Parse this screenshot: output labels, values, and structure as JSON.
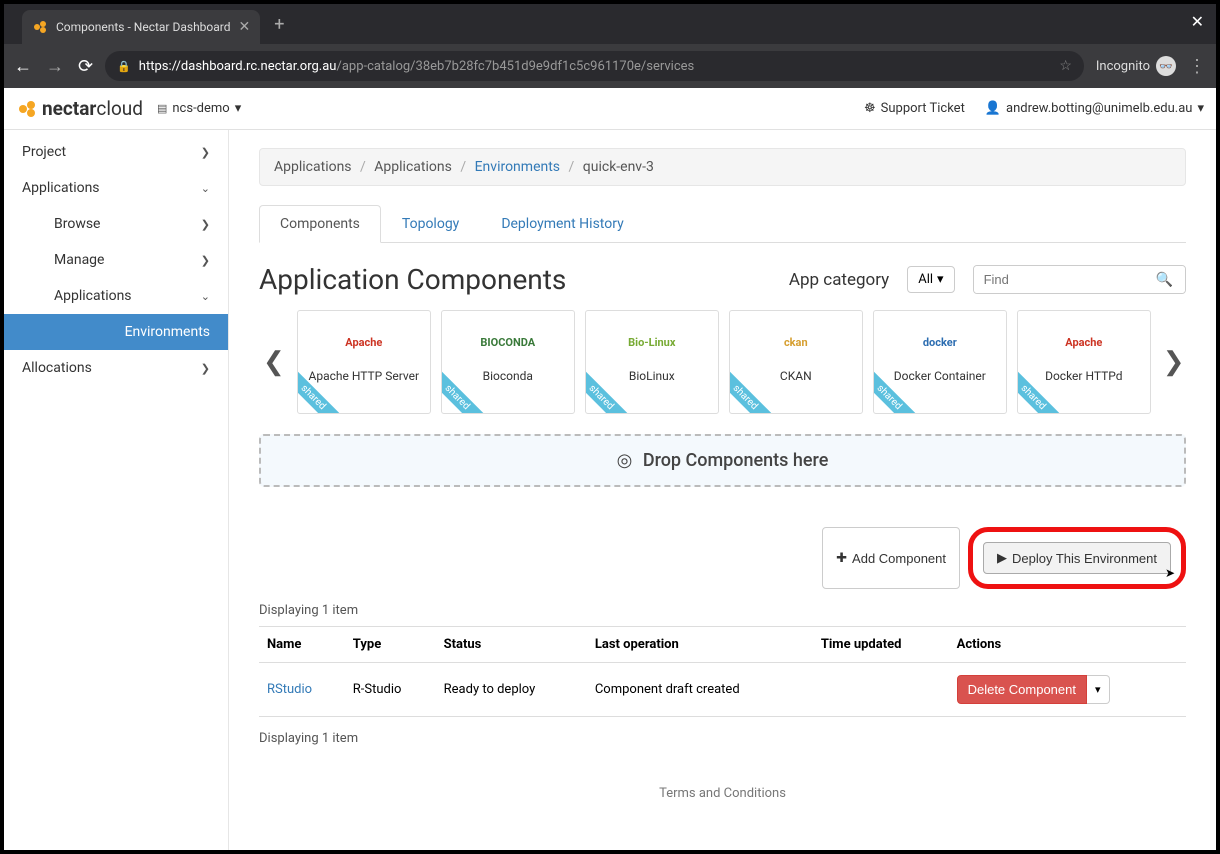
{
  "browser": {
    "tab_title": "Components - Nectar Dashboard",
    "url_host": "https://dashboard.rc.nectar.org.au",
    "url_path": "/app-catalog/38eb7b28fc7b451d9e9df1c5c961170e/services",
    "incognito_label": "Incognito"
  },
  "topbar": {
    "brand_bold": "nectar",
    "brand_light": "cloud",
    "project_switcher": "ncs-demo",
    "support_label": "Support Ticket",
    "user_label": "andrew.botting@unimelb.edu.au"
  },
  "sidebar": {
    "project": "Project",
    "applications": "Applications",
    "browse": "Browse",
    "manage": "Manage",
    "apps_sub": "Applications",
    "environments": "Environments",
    "allocations": "Allocations"
  },
  "breadcrumb": {
    "items": [
      "Applications",
      "Applications",
      "Environments",
      "quick-env-3"
    ]
  },
  "tabs": {
    "components": "Components",
    "topology": "Topology",
    "history": "Deployment History"
  },
  "section": {
    "title": "Application Components",
    "category_label": "App category",
    "category_value": "All",
    "search_placeholder": "Find"
  },
  "cards": [
    {
      "label": "Apache HTTP Server",
      "icon_text": "Apache",
      "shared": true
    },
    {
      "label": "Bioconda",
      "icon_text": "BIOCONDA",
      "shared": true
    },
    {
      "label": "BioLinux",
      "icon_text": "Bio-Linux",
      "shared": true
    },
    {
      "label": "CKAN",
      "icon_text": "ckan",
      "shared": true
    },
    {
      "label": "Docker Container",
      "icon_text": "docker",
      "shared": true
    },
    {
      "label": "Docker HTTPd",
      "icon_text": "Apache",
      "shared": true
    }
  ],
  "shared_label": "shared",
  "drop_zone": "Drop Components here",
  "actions": {
    "add": "Add Component",
    "deploy": "Deploy This Environment"
  },
  "table": {
    "displaying": "Displaying 1 item",
    "headers": {
      "name": "Name",
      "type": "Type",
      "status": "Status",
      "last_op": "Last operation",
      "time": "Time updated",
      "actions": "Actions"
    },
    "rows": [
      {
        "name": "RStudio",
        "type": "R-Studio",
        "status": "Ready to deploy",
        "last_op": "Component draft created",
        "time": "",
        "action": "Delete Component"
      }
    ]
  },
  "footer": "Terms and Conditions"
}
